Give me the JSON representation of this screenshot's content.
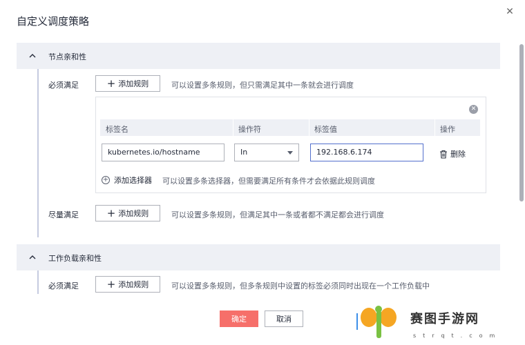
{
  "dialog": {
    "title": "自定义调度策略",
    "close_glyph": "✕"
  },
  "node_affinity": {
    "title": "节点亲和性",
    "required": {
      "label": "必须满足",
      "add_rule": "添加规则",
      "hint": "可以设置多条规则，但只需满足其中一条就会进行调度"
    },
    "rule_box": {
      "columns": [
        "标签名",
        "操作符",
        "标签值",
        "操作"
      ],
      "row": {
        "label_name": "kubernetes.io/hostname",
        "operator": "In",
        "label_value": "192.168.6.174",
        "delete": "删除"
      },
      "add_selector": "添加选择器",
      "add_selector_hint": "可以设置多条选择器，但需要满足所有条件才会依据此规则调度"
    },
    "preferred": {
      "label": "尽量满足",
      "add_rule": "添加规则",
      "hint": "可以设置多条规则，但满足其中一条或者都不满足都会进行调度"
    }
  },
  "workload_affinity": {
    "title": "工作负载亲和性",
    "required": {
      "label": "必须满足",
      "add_rule": "添加规则",
      "hint": "可以设置多条规则，但多条规则中设置的标签必须同时出现在一个工作负载中"
    }
  },
  "footer": {
    "ok": "确定",
    "cancel": "取消"
  },
  "watermark": {
    "text": "赛图手游网",
    "sub": "strqt.com"
  },
  "colors": {
    "primary_button": "#f66f6a",
    "section_bg": "#eef0f5",
    "active_border": "#526ecc"
  }
}
